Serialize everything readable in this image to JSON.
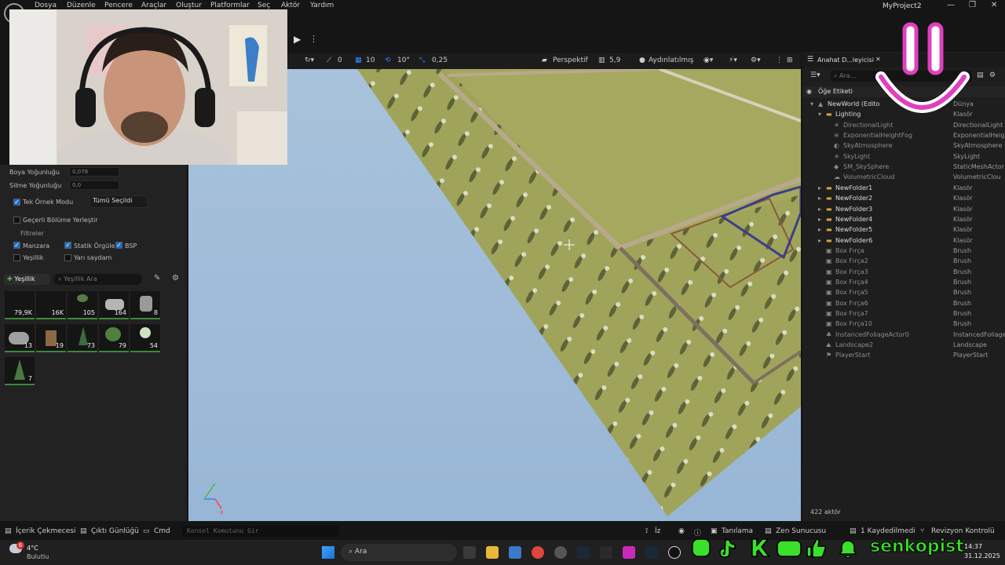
{
  "menu": {
    "items": [
      "Dosya",
      "Düzenle",
      "Pencere",
      "Araçlar",
      "Oluştur",
      "Platformlar",
      "Seç",
      "Aktör",
      "Yardım"
    ]
  },
  "window": {
    "project": "MyProject2",
    "logo": "UE"
  },
  "viewport_toolbar": {
    "snap_angle": "0",
    "grid_snap": "10",
    "rotate_snap": "10°",
    "scale_snap": "0,25",
    "perspective": "Perspektif",
    "camera_speed": "5,9",
    "lighting": "Aydınlatılmış"
  },
  "foliage_panel": {
    "paint_density_label": "Boya Yoğunluğu",
    "paint_density_value": "0,078",
    "erase_density_label": "Silme Yoğunluğu",
    "erase_density_value": "0,0",
    "single_instance_label": "Tek Örnek Modu",
    "single_instance_value": "Tümü Seçildi",
    "place_in_level_label": "Geçerli Bölüme Yerleştir",
    "filters_label": "Filtreler",
    "filter_landscape": "Manzara",
    "filter_static_mesh": "Statik Örgüler",
    "filter_bsp": "BSP",
    "filter_foliage": "Yeşillik",
    "filter_translucent": "Yarı saydam",
    "add_button": "Yeşillik",
    "search_placeholder": "Yeşillik Ara",
    "thumbs": [
      "79,9K",
      "16K",
      "105",
      "164",
      "8",
      "13",
      "19",
      "73",
      "79",
      "54",
      "7"
    ]
  },
  "outliner": {
    "tab": "Anahat D...leyicisi",
    "search_placeholder": "Ara...",
    "header": "Öğe Etiketi",
    "rows": [
      {
        "name": "NewWorld (Edito",
        "type": "Dünya",
        "indent": 1,
        "icon": "world"
      },
      {
        "name": "Lighting",
        "type": "Klasör",
        "indent": 2,
        "icon": "folder"
      },
      {
        "name": "DirectionalLight",
        "type": "DirectionalLight",
        "indent": 3,
        "icon": "light",
        "dim": true
      },
      {
        "name": "ExponentialHeightFog",
        "type": "ExponentialHeigh",
        "indent": 3,
        "icon": "fog",
        "dim": true
      },
      {
        "name": "SkyAtmosphere",
        "type": "SkyAtmosphere",
        "indent": 3,
        "icon": "sky",
        "dim": true
      },
      {
        "name": "SkyLight",
        "type": "SkyLight",
        "indent": 3,
        "icon": "light",
        "dim": true
      },
      {
        "name": "SM_SkySphere",
        "type": "StaticMeshActor",
        "indent": 3,
        "icon": "mesh",
        "dim": true
      },
      {
        "name": "VolumetricCloud",
        "type": "VolumetricClou",
        "indent": 3,
        "icon": "cloud",
        "dim": true
      },
      {
        "name": "NewFolder1",
        "type": "Klasör",
        "indent": 2,
        "icon": "folder"
      },
      {
        "name": "NewFolder2",
        "type": "Klasör",
        "indent": 2,
        "icon": "folder"
      },
      {
        "name": "NewFolder3",
        "type": "Klasör",
        "indent": 2,
        "icon": "folder"
      },
      {
        "name": "NewFolder4",
        "type": "Klasör",
        "indent": 2,
        "icon": "folder"
      },
      {
        "name": "NewFolder5",
        "type": "Klasör",
        "indent": 2,
        "icon": "folder"
      },
      {
        "name": "NewFolder6",
        "type": "Klasör",
        "indent": 2,
        "icon": "folder"
      },
      {
        "name": "Box Fırça",
        "type": "Brush",
        "indent": 2,
        "icon": "brush",
        "dim": true
      },
      {
        "name": "Box Fırça2",
        "type": "Brush",
        "indent": 2,
        "icon": "brush",
        "dim": true
      },
      {
        "name": "Box Fırça3",
        "type": "Brush",
        "indent": 2,
        "icon": "brush",
        "dim": true
      },
      {
        "name": "Box Fırça4",
        "type": "Brush",
        "indent": 2,
        "icon": "brush",
        "dim": true
      },
      {
        "name": "Box Fırça5",
        "type": "Brush",
        "indent": 2,
        "icon": "brush",
        "dim": true
      },
      {
        "name": "Box Fırça6",
        "type": "Brush",
        "indent": 2,
        "icon": "brush",
        "dim": true
      },
      {
        "name": "Box Fırça7",
        "type": "Brush",
        "indent": 2,
        "icon": "brush",
        "dim": true
      },
      {
        "name": "Box Fırça10",
        "type": "Brush",
        "indent": 2,
        "icon": "brush",
        "dim": true
      },
      {
        "name": "InstancedFoliageActor0",
        "type": "InstancedFoliage",
        "indent": 2,
        "icon": "foliage",
        "dim": true
      },
      {
        "name": "Landscape2",
        "type": "Landscape",
        "indent": 2,
        "icon": "landscape",
        "dim": true
      },
      {
        "name": "PlayerStart",
        "type": "PlayerStart",
        "indent": 2,
        "icon": "player",
        "dim": true
      }
    ],
    "actor_count": "422 aktör"
  },
  "statusbar": {
    "content_drawer": "İçerik Çekmecesi",
    "output_log": "Çıktı Günlüğü",
    "cmd": "Cmd",
    "console_placeholder": "Konsol Komutunu Gir",
    "trace": "İz",
    "derive": "Tanılama",
    "zen": "Zen Sunucusu",
    "saved": "1 Kaydedilmedi",
    "revision": "Revizyon Kontrolü"
  },
  "taskbar": {
    "weather_temp": "4°C",
    "weather_desc": "Bulutlu",
    "weather_badge": "6",
    "search": "Ara",
    "time": "14:37",
    "date": "31.12.2025"
  },
  "overlay": {
    "handle": "senkopist"
  },
  "colors": {
    "accent": "#0070e0",
    "ground": "#9fa45a",
    "sky": "#a5bfd9",
    "smile": "#e040c0"
  }
}
